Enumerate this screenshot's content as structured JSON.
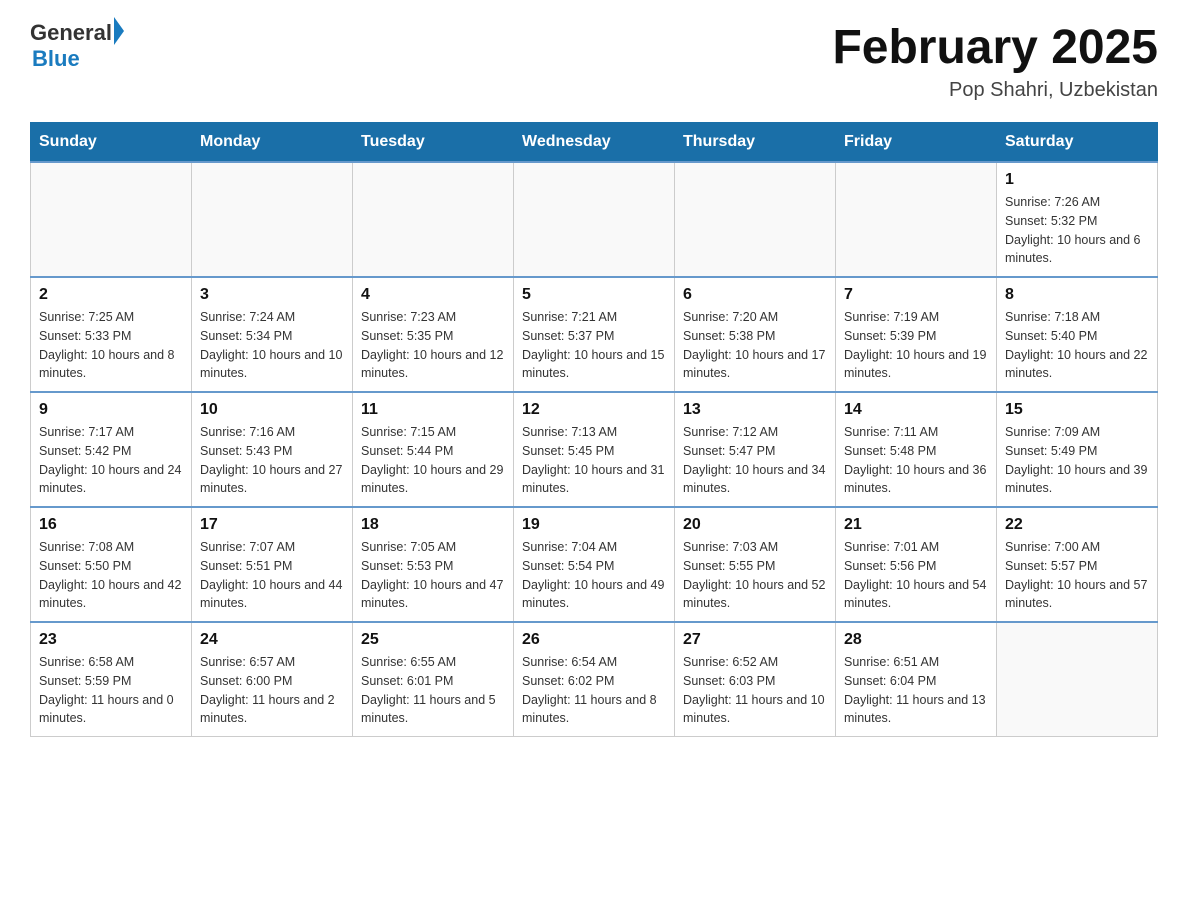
{
  "header": {
    "logo_general": "General",
    "logo_blue": "Blue",
    "month_title": "February 2025",
    "location": "Pop Shahri, Uzbekistan"
  },
  "days_of_week": [
    "Sunday",
    "Monday",
    "Tuesday",
    "Wednesday",
    "Thursday",
    "Friday",
    "Saturday"
  ],
  "weeks": [
    [
      {
        "day": "",
        "info": ""
      },
      {
        "day": "",
        "info": ""
      },
      {
        "day": "",
        "info": ""
      },
      {
        "day": "",
        "info": ""
      },
      {
        "day": "",
        "info": ""
      },
      {
        "day": "",
        "info": ""
      },
      {
        "day": "1",
        "info": "Sunrise: 7:26 AM\nSunset: 5:32 PM\nDaylight: 10 hours and 6 minutes."
      }
    ],
    [
      {
        "day": "2",
        "info": "Sunrise: 7:25 AM\nSunset: 5:33 PM\nDaylight: 10 hours and 8 minutes."
      },
      {
        "day": "3",
        "info": "Sunrise: 7:24 AM\nSunset: 5:34 PM\nDaylight: 10 hours and 10 minutes."
      },
      {
        "day": "4",
        "info": "Sunrise: 7:23 AM\nSunset: 5:35 PM\nDaylight: 10 hours and 12 minutes."
      },
      {
        "day": "5",
        "info": "Sunrise: 7:21 AM\nSunset: 5:37 PM\nDaylight: 10 hours and 15 minutes."
      },
      {
        "day": "6",
        "info": "Sunrise: 7:20 AM\nSunset: 5:38 PM\nDaylight: 10 hours and 17 minutes."
      },
      {
        "day": "7",
        "info": "Sunrise: 7:19 AM\nSunset: 5:39 PM\nDaylight: 10 hours and 19 minutes."
      },
      {
        "day": "8",
        "info": "Sunrise: 7:18 AM\nSunset: 5:40 PM\nDaylight: 10 hours and 22 minutes."
      }
    ],
    [
      {
        "day": "9",
        "info": "Sunrise: 7:17 AM\nSunset: 5:42 PM\nDaylight: 10 hours and 24 minutes."
      },
      {
        "day": "10",
        "info": "Sunrise: 7:16 AM\nSunset: 5:43 PM\nDaylight: 10 hours and 27 minutes."
      },
      {
        "day": "11",
        "info": "Sunrise: 7:15 AM\nSunset: 5:44 PM\nDaylight: 10 hours and 29 minutes."
      },
      {
        "day": "12",
        "info": "Sunrise: 7:13 AM\nSunset: 5:45 PM\nDaylight: 10 hours and 31 minutes."
      },
      {
        "day": "13",
        "info": "Sunrise: 7:12 AM\nSunset: 5:47 PM\nDaylight: 10 hours and 34 minutes."
      },
      {
        "day": "14",
        "info": "Sunrise: 7:11 AM\nSunset: 5:48 PM\nDaylight: 10 hours and 36 minutes."
      },
      {
        "day": "15",
        "info": "Sunrise: 7:09 AM\nSunset: 5:49 PM\nDaylight: 10 hours and 39 minutes."
      }
    ],
    [
      {
        "day": "16",
        "info": "Sunrise: 7:08 AM\nSunset: 5:50 PM\nDaylight: 10 hours and 42 minutes."
      },
      {
        "day": "17",
        "info": "Sunrise: 7:07 AM\nSunset: 5:51 PM\nDaylight: 10 hours and 44 minutes."
      },
      {
        "day": "18",
        "info": "Sunrise: 7:05 AM\nSunset: 5:53 PM\nDaylight: 10 hours and 47 minutes."
      },
      {
        "day": "19",
        "info": "Sunrise: 7:04 AM\nSunset: 5:54 PM\nDaylight: 10 hours and 49 minutes."
      },
      {
        "day": "20",
        "info": "Sunrise: 7:03 AM\nSunset: 5:55 PM\nDaylight: 10 hours and 52 minutes."
      },
      {
        "day": "21",
        "info": "Sunrise: 7:01 AM\nSunset: 5:56 PM\nDaylight: 10 hours and 54 minutes."
      },
      {
        "day": "22",
        "info": "Sunrise: 7:00 AM\nSunset: 5:57 PM\nDaylight: 10 hours and 57 minutes."
      }
    ],
    [
      {
        "day": "23",
        "info": "Sunrise: 6:58 AM\nSunset: 5:59 PM\nDaylight: 11 hours and 0 minutes."
      },
      {
        "day": "24",
        "info": "Sunrise: 6:57 AM\nSunset: 6:00 PM\nDaylight: 11 hours and 2 minutes."
      },
      {
        "day": "25",
        "info": "Sunrise: 6:55 AM\nSunset: 6:01 PM\nDaylight: 11 hours and 5 minutes."
      },
      {
        "day": "26",
        "info": "Sunrise: 6:54 AM\nSunset: 6:02 PM\nDaylight: 11 hours and 8 minutes."
      },
      {
        "day": "27",
        "info": "Sunrise: 6:52 AM\nSunset: 6:03 PM\nDaylight: 11 hours and 10 minutes."
      },
      {
        "day": "28",
        "info": "Sunrise: 6:51 AM\nSunset: 6:04 PM\nDaylight: 11 hours and 13 minutes."
      },
      {
        "day": "",
        "info": ""
      }
    ]
  ]
}
